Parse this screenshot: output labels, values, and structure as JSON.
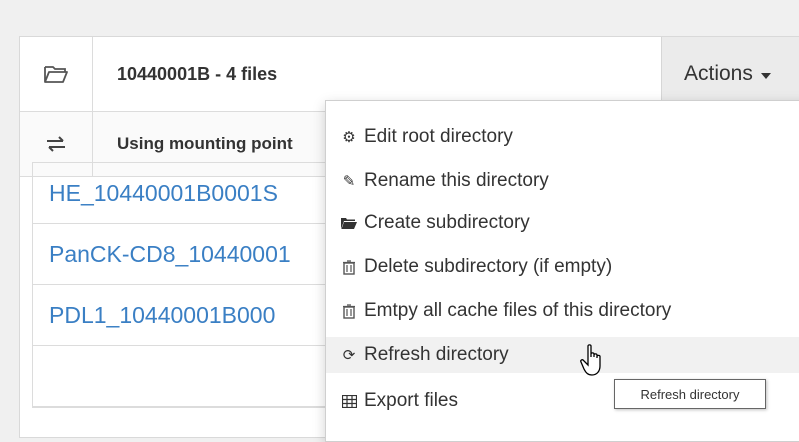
{
  "header": {
    "title": "10440001B - 4 files",
    "actions_label": "Actions",
    "mount_text": "Using mounting point"
  },
  "files": [
    {
      "name": "HE_10440001B0001S"
    },
    {
      "name": "PanCK-CD8_10440001"
    },
    {
      "name": "PDL1_10440001B000"
    }
  ],
  "menu": {
    "items": [
      {
        "icon": "cogs-icon",
        "label": "Edit root directory"
      },
      {
        "icon": "pencil-icon",
        "label": "Rename this directory"
      },
      {
        "icon": "folder-open-icon",
        "label": "Create subdirectory"
      },
      {
        "icon": "trash-icon",
        "label": "Delete subdirectory (if empty)"
      },
      {
        "icon": "trash-icon",
        "label": "Emtpy all cache files of this directory"
      },
      {
        "icon": "refresh-icon",
        "label": "Refresh directory"
      },
      {
        "icon": "table-icon",
        "label": "Export files"
      }
    ]
  },
  "tooltip": {
    "text": "Refresh directory"
  },
  "colors": {
    "link": "#3a7fc4",
    "actions_bg": "#ebebeb",
    "highlight": "#f1f1f1"
  }
}
